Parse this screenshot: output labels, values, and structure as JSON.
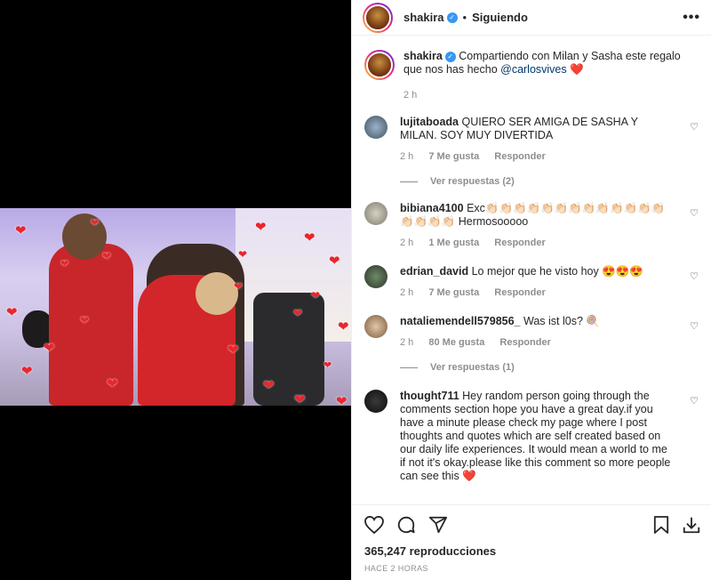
{
  "header": {
    "username": "shakira",
    "separator": "•",
    "follow_status": "Siguiendo",
    "more": "•••"
  },
  "caption": {
    "username": "shakira",
    "text": "Compartiendo con Milan y Sasha este regalo que nos has hecho",
    "mention": "@carlosvives",
    "emoji": "❤️",
    "time": "2 h"
  },
  "comments": [
    {
      "username": "lujitaboada",
      "text": "QUIERO SER AMIGA DE SASHA Y MILAN. SOY MUY DIVERTIDA",
      "time": "2 h",
      "likes": "7 Me gusta",
      "reply": "Responder",
      "replies": "Ver respuestas (2)"
    },
    {
      "username": "bibiana4100",
      "text": "Exc👏🏻👏🏻👏🏻👏🏻👏🏻👏🏻👏🏻👏🏻👏🏻👏🏻👏🏻👏🏻👏🏻👏🏻👏🏻👏🏻👏🏻 Hermosooooo",
      "time": "2 h",
      "likes": "1 Me gusta",
      "reply": "Responder"
    },
    {
      "username": "edrian_david",
      "text": "Lo mejor que he visto hoy 😍😍😍",
      "time": "2 h",
      "likes": "7 Me gusta",
      "reply": "Responder"
    },
    {
      "username": "nataliemendell579856_",
      "text": "Was ist l0s? 🍭",
      "time": "2 h",
      "likes": "80 Me gusta",
      "reply": "Responder",
      "replies": "Ver respuestas (1)"
    },
    {
      "username": "thought711",
      "text": "Hey random person going through the comments section hope you have a great day.if you have a minute please check my page where I post thoughts and quotes which are self created based on our daily life experiences. It would mean a world to me if not it's okay.please like this comment so more people can see this ❤️"
    }
  ],
  "stats": {
    "views": "365,247 reproducciones",
    "posted": "HACE 2 HORAS"
  },
  "icons": [
    "heart-icon",
    "comment-icon",
    "share-icon",
    "bookmark-icon",
    "download-icon"
  ],
  "colors": {
    "accent": "#3897f0",
    "heart": "#e8262d",
    "muted": "#8e8e8e"
  }
}
